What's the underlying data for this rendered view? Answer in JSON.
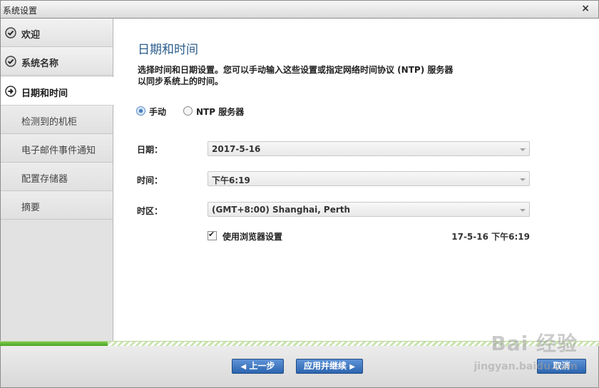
{
  "window": {
    "title": "系统设置",
    "close_icon": "×"
  },
  "sidebar": {
    "items": [
      {
        "label": "欢迎",
        "state": "done"
      },
      {
        "label": "系统名称",
        "state": "done"
      },
      {
        "label": "日期和时间",
        "state": "active"
      },
      {
        "label": "检测到的机柜",
        "state": "pending"
      },
      {
        "label": "电子邮件事件通知",
        "state": "pending"
      },
      {
        "label": "配置存储器",
        "state": "pending"
      },
      {
        "label": "摘要",
        "state": "pending"
      }
    ]
  },
  "main": {
    "heading": "日期和时间",
    "description_line1": "选择时间和日期设置。您可以手动输入这些设置或指定网络时间协议 (NTP) 服务器",
    "description_line2": "以同步系统上的时间。",
    "radio_manual": "手动",
    "radio_ntp": "NTP 服务器",
    "selected_mode": "manual",
    "date_label": "日期：",
    "date_value": "2017-5-16",
    "time_label": "时间：",
    "time_value": "下午6:19",
    "timezone_label": "时区：",
    "timezone_value": "(GMT+8:00) Shanghai, Perth",
    "use_browser_label": "使用浏览器设置",
    "use_browser_checked": true,
    "browser_time": "17-5-16 下午6:19"
  },
  "progress": {
    "fraction": 0.18
  },
  "footer": {
    "back_label": "上一步",
    "apply_label": "应用并继续",
    "cancel_label": "取消"
  },
  "watermark": {
    "brand": "Bai 经验",
    "site": "jingyan.baidu.com"
  },
  "colors": {
    "accent": "#2b5d8c",
    "button": "#3b74bf",
    "progress": "#5db435"
  }
}
